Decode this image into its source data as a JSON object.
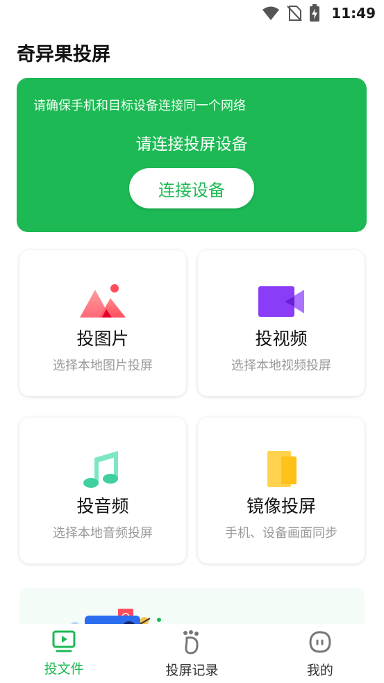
{
  "status": {
    "time": "11:49",
    "icons": [
      "wifi-icon",
      "no-sim-icon",
      "battery-charging-icon"
    ]
  },
  "app": {
    "title": "奇异果投屏"
  },
  "banner": {
    "tip": "请确保手机和目标设备连接同一个网络",
    "prompt": "请连接投屏设备",
    "button_label": "连接设备",
    "bg_color": "#1db954"
  },
  "cards": [
    {
      "title": "投图片",
      "subtitle": "选择本地图片投屏",
      "icon": "image-icon"
    },
    {
      "title": "投视频",
      "subtitle": "选择本地视频投屏",
      "icon": "video-icon"
    },
    {
      "title": "投音频",
      "subtitle": "选择本地音频投屏",
      "icon": "music-icon"
    },
    {
      "title": "镜像投屏",
      "subtitle": "手机、设备画面同步",
      "icon": "mirror-icon"
    }
  ],
  "nav": {
    "items": [
      {
        "label": "投文件",
        "icon": "tv-play-icon",
        "active": true
      },
      {
        "label": "投屏记录",
        "icon": "footprint-icon",
        "active": false
      },
      {
        "label": "我的",
        "icon": "profile-face-icon",
        "active": false
      }
    ],
    "active_color": "#1db954"
  }
}
